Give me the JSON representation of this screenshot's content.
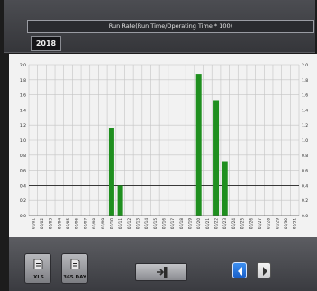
{
  "header": {
    "title": "Run Rate(Run Time/Operating Time * 100)",
    "year": "2018"
  },
  "chart_data": {
    "type": "bar",
    "categories": [
      "01/01",
      "01/02",
      "01/03",
      "01/04",
      "01/05",
      "01/06",
      "01/07",
      "01/08",
      "01/09",
      "01/10",
      "01/11",
      "01/12",
      "01/13",
      "01/14",
      "01/15",
      "01/16",
      "01/17",
      "01/18",
      "01/19",
      "01/20",
      "01/21",
      "01/22",
      "01/23",
      "01/24",
      "01/25",
      "01/26",
      "01/27",
      "01/28",
      "01/29",
      "01/30",
      "01/31"
    ],
    "values": [
      0,
      0,
      0,
      0,
      0,
      0,
      0,
      0,
      0,
      1.16,
      0.4,
      0,
      0,
      0,
      0,
      0,
      0,
      0,
      0,
      1.88,
      0,
      1.53,
      0.72,
      0,
      0,
      0,
      0,
      0,
      0,
      0,
      0
    ],
    "ylim": [
      0,
      2.0
    ],
    "yticks": [
      "0.0",
      "0.2",
      "0.4",
      "0.6",
      "0.8",
      "1.0",
      "1.2",
      "1.4",
      "1.6",
      "1.8",
      "2.0"
    ],
    "reference_line": 0.4,
    "grid": true,
    "bar_color": "#1f8f1f"
  },
  "footer": {
    "export_xls_label": ".XLS",
    "export_365_label": "365 DAY"
  }
}
